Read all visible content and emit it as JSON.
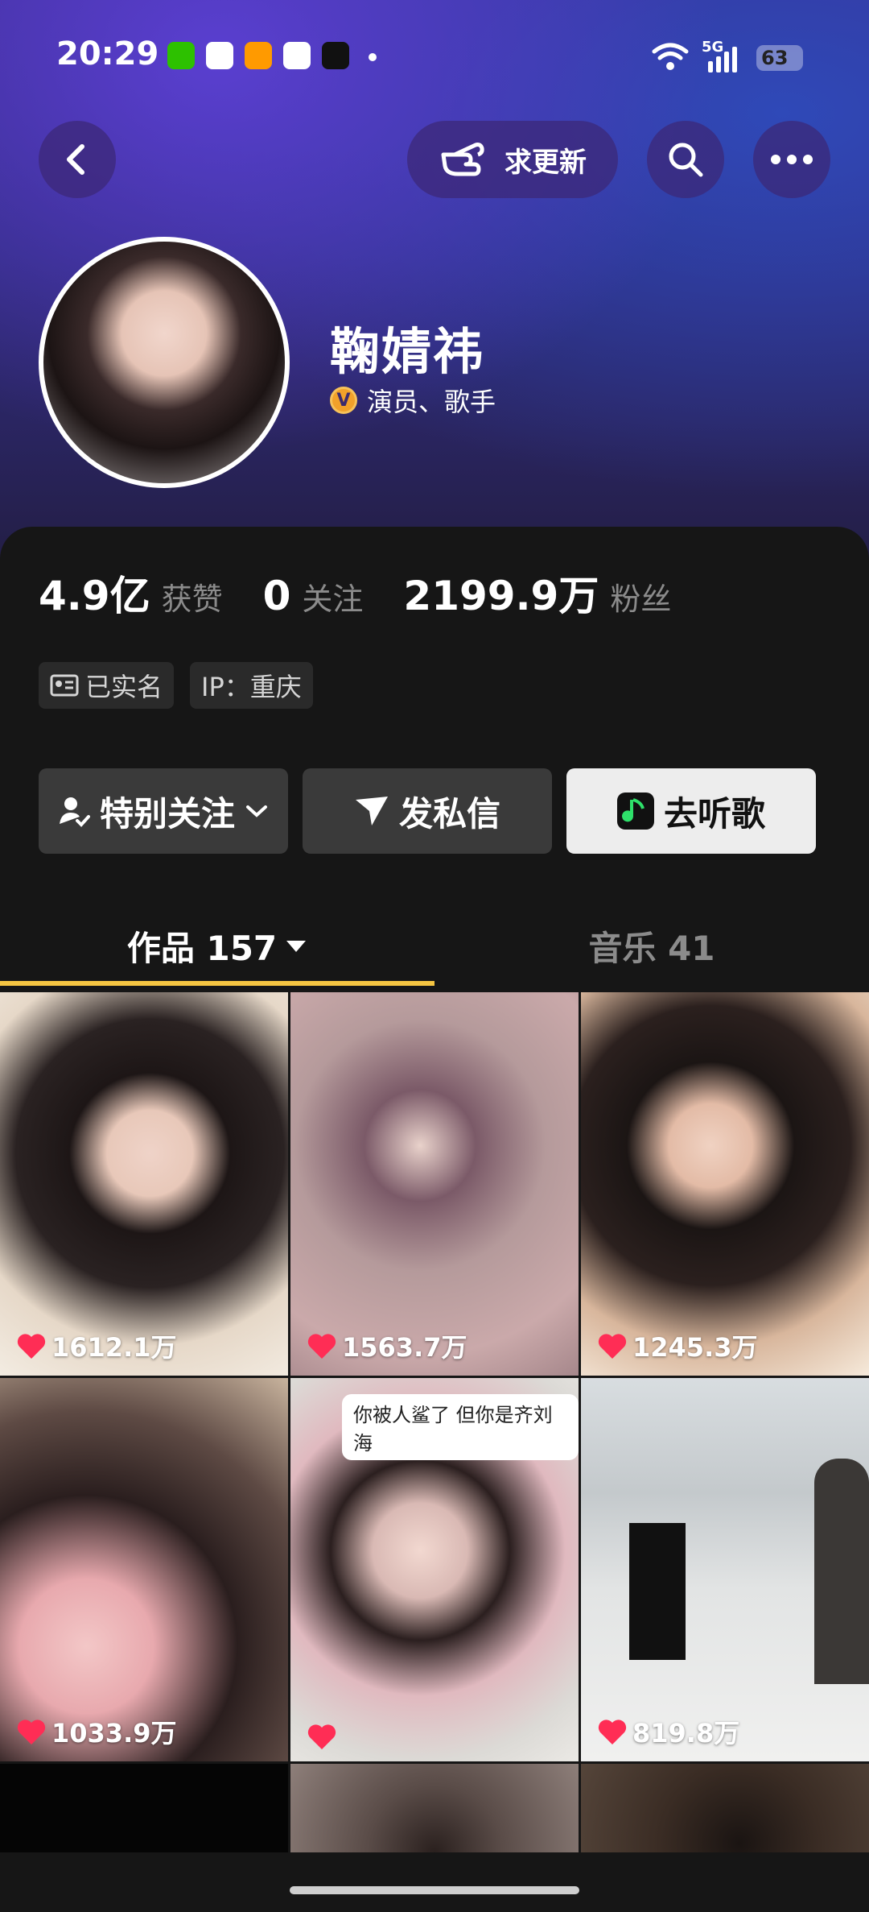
{
  "status_bar": {
    "time": "20:29",
    "network": "5G",
    "battery": "63"
  },
  "nav": {
    "update_label": "求更新"
  },
  "profile": {
    "name": "鞠婧祎",
    "role": "演员、歌手",
    "verified_glyph": "V"
  },
  "stats": [
    {
      "value": "4.9亿",
      "label": "获赞"
    },
    {
      "value": "0",
      "label": "关注"
    },
    {
      "value": "2199.9万",
      "label": "粉丝"
    }
  ],
  "tags": {
    "realname": "已实名",
    "ip": "IP：重庆"
  },
  "actions": {
    "follow": "特别关注",
    "message": "发私信",
    "music": "去听歌"
  },
  "tabs": {
    "works": "作品 157",
    "music": "音乐 41"
  },
  "videos": [
    {
      "likes": "1612.1万"
    },
    {
      "likes": "1563.7万"
    },
    {
      "likes": "1245.3万"
    },
    {
      "likes": "1033.9万"
    },
    {
      "likes": "",
      "caption": "你被人鲨了 但你是齐刘海"
    },
    {
      "likes": "819.8万"
    }
  ],
  "colors": {
    "accent_tab": "#f5c542",
    "like_heart": "#ff2d55",
    "verified": "#f1a12a"
  }
}
